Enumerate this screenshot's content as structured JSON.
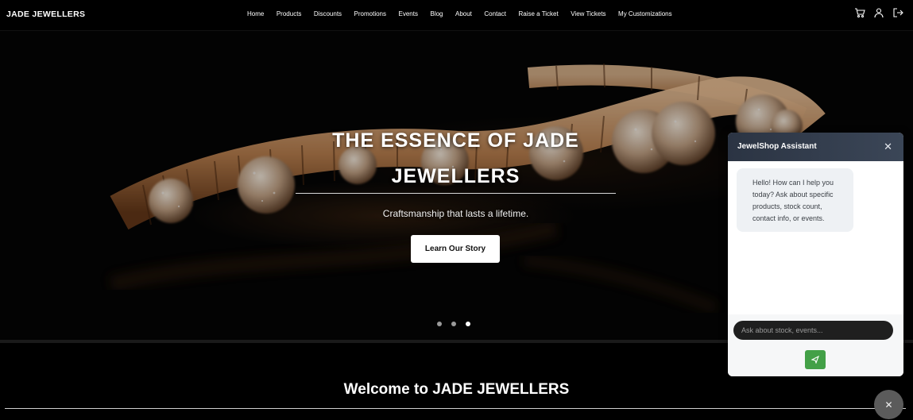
{
  "navbar": {
    "brand": "JADE JEWELLERS",
    "links": [
      "Home",
      "Products",
      "Discounts",
      "Promotions",
      "Events",
      "Blog",
      "About",
      "Contact",
      "Raise a Ticket",
      "View Tickets",
      "My Customizations"
    ],
    "icons": [
      "cart-icon",
      "user-icon",
      "logout-icon"
    ]
  },
  "hero": {
    "title_line1": "THE ESSENCE OF JADE",
    "title_line2": "JEWELLERS",
    "subtitle": "Craftsmanship that lasts a lifetime.",
    "button_label": "Learn Our Story",
    "slides_total": 3,
    "active_slide": 3,
    "image_subject": "gold-diamond-bracelet"
  },
  "welcome": {
    "heading": "Welcome to JADE JEWELLERS"
  },
  "chat": {
    "title": "JewelShop Assistant",
    "close_icon": "close-icon",
    "messages": [
      {
        "from": "bot",
        "text": "Hello! How can I help you today? Ask about specific products, stock count, contact info, or events."
      }
    ],
    "input_placeholder": "Ask about stock, events...",
    "send_icon": "send-icon",
    "fab_icon": "close-icon"
  },
  "colors": {
    "background": "#000000",
    "chat_header": "#2b3443",
    "send_button": "#43a047",
    "hero_button": "#ffffff",
    "fab": "#5b5b5b"
  }
}
